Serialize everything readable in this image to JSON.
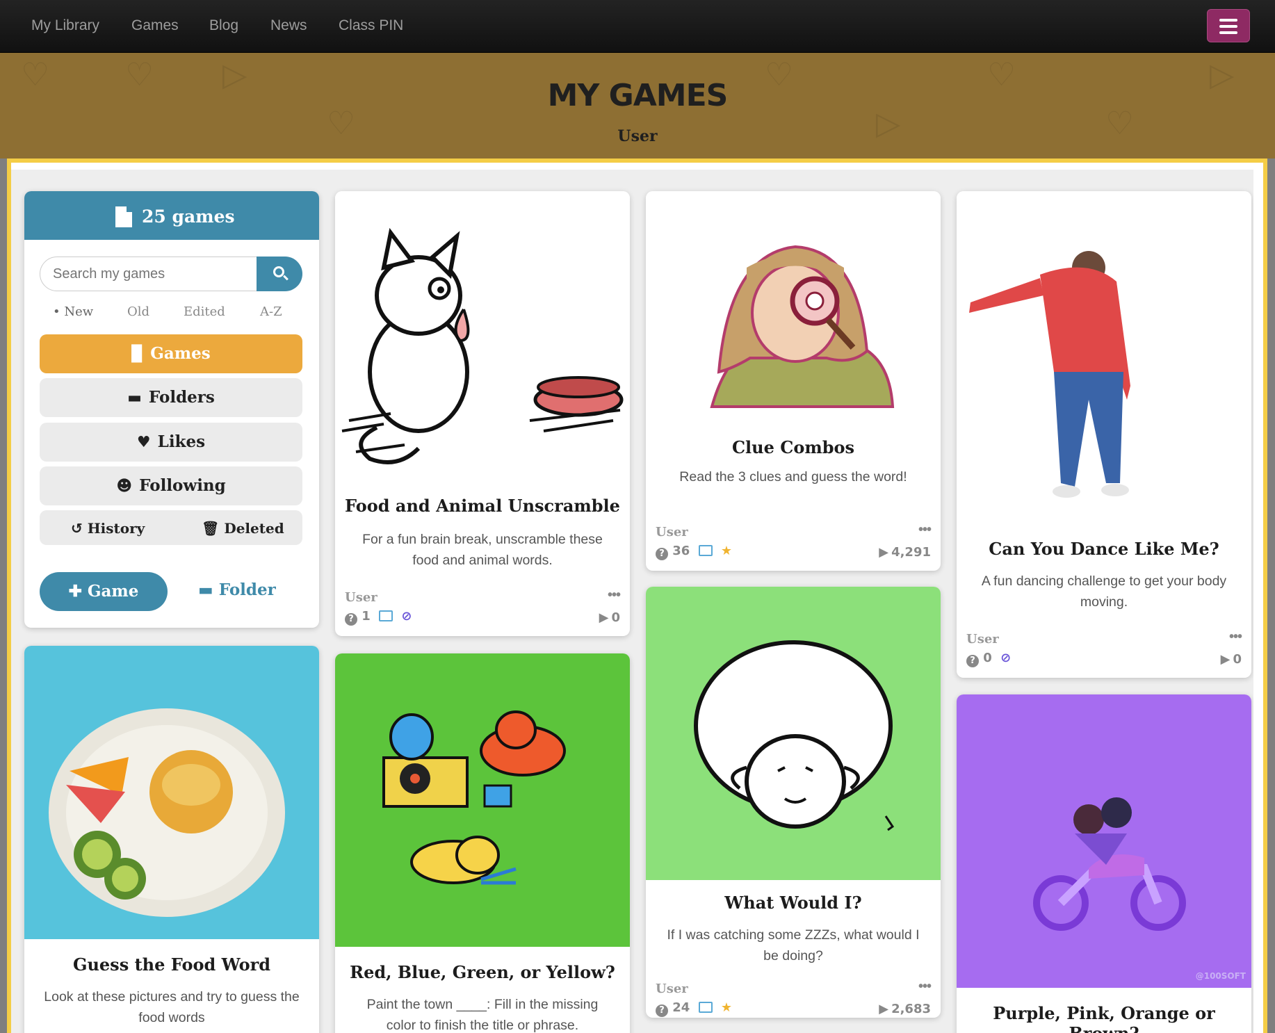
{
  "nav": {
    "links": [
      "My Library",
      "Games",
      "Blog",
      "News",
      "Class PIN"
    ]
  },
  "hero": {
    "title": "MY GAMES",
    "subtitle": "User"
  },
  "sidebar": {
    "count_label": "25 games",
    "search_placeholder": "Search my games",
    "sort": {
      "new": "• New",
      "old": "Old",
      "edited": "Edited",
      "az": "A-Z"
    },
    "menu": {
      "games": "Games",
      "folders": "Folders",
      "likes": "Likes",
      "following": "Following",
      "history": "History",
      "deleted": "Deleted"
    },
    "add_game": "Game",
    "add_folder": "Folder"
  },
  "cards": [
    {
      "title": "Food and Animal Unscramble",
      "desc": "For a fun brain break, unscramble these food and animal words.",
      "user": "User",
      "questions": "1",
      "plays": "0",
      "bg": "#ffffff"
    },
    {
      "title": "Clue Combos",
      "desc": "Read the 3 clues and guess the word!",
      "user": "User",
      "questions": "36",
      "plays": "4,291",
      "bg": "#ffffff"
    },
    {
      "title": "Can You Dance Like Me?",
      "desc": "A fun dancing challenge to get your body moving.",
      "user": "User",
      "questions": "0",
      "plays": "0",
      "bg": "#ffffff"
    },
    {
      "title": "Guess the Food Word",
      "desc": "Look at these pictures and try to guess the food words",
      "bg": "#56c3dc"
    },
    {
      "title": "Red, Blue, Green, or Yellow?",
      "desc": "Paint the town ____: Fill in the missing color to finish the title or phrase.",
      "bg": "#5cc43b"
    },
    {
      "title": "What Would I?",
      "desc": "If I was catching some ZZZs, what would I be doing?",
      "user": "User",
      "questions": "24",
      "plays": "2,683",
      "bg": "#8ce07a"
    },
    {
      "title": "Purple, Pink, Orange or Brown?",
      "bg": "#a66cf0",
      "watermark": "@100SOFT"
    }
  ],
  "colors": {
    "brand_blue": "#3f8aa9",
    "active_orange": "#eca93d",
    "frame_yellow": "#f4cd46",
    "hero_brown": "#8e6f33",
    "menu_purple": "#8e2a63"
  }
}
